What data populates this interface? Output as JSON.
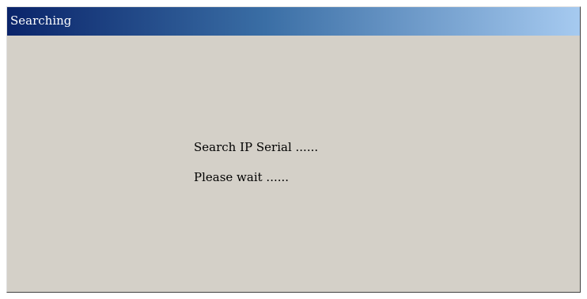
{
  "window": {
    "title": "Searching"
  },
  "dialog": {
    "message_line_1": "Search IP Serial ......",
    "message_line_2": "Please wait ......"
  },
  "colors": {
    "window_background": "#d4d0c8",
    "titlebar_start": "#0a246a",
    "titlebar_end": "#a6caf0",
    "title_text": "#ffffff",
    "body_text": "#000000"
  }
}
